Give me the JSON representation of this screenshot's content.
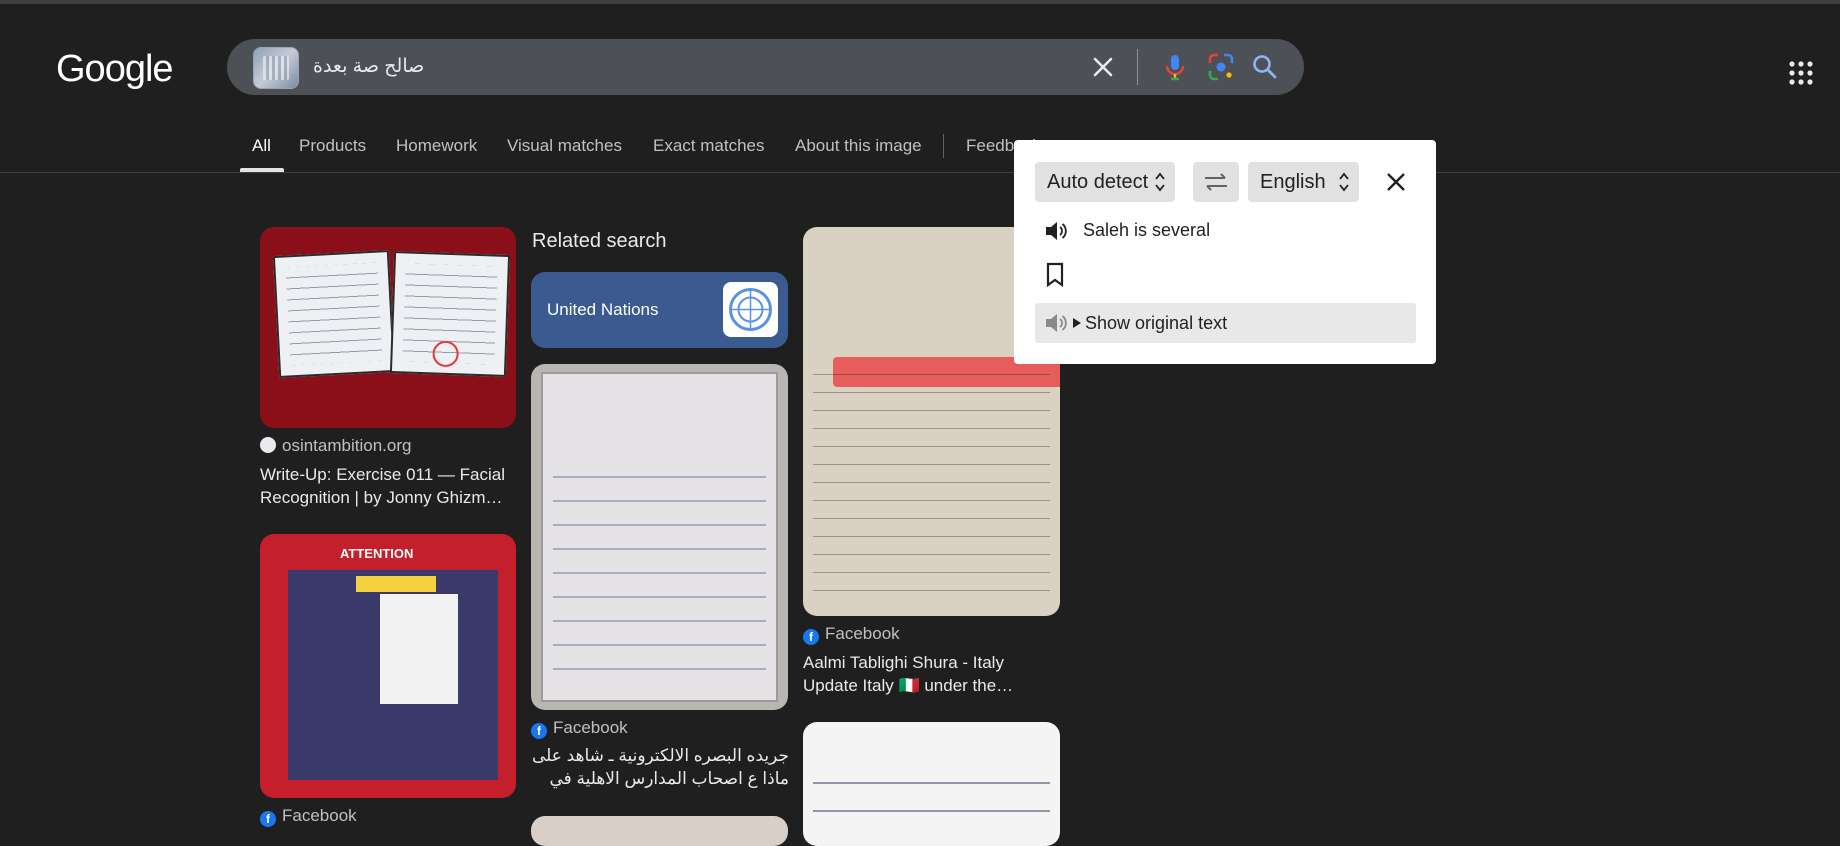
{
  "header": {
    "logo": "Google",
    "search": {
      "query": "صالح صة بعدة"
    }
  },
  "tabs": [
    {
      "label": "All"
    },
    {
      "label": "Products"
    },
    {
      "label": "Homework"
    },
    {
      "label": "Visual matches"
    },
    {
      "label": "Exact matches"
    },
    {
      "label": "About this image"
    },
    {
      "label": "Feedback"
    }
  ],
  "results": {
    "col1": [
      {
        "source": "osintambition.org",
        "title": "Write-Up: Exercise 011 — Facial Recognition | by Jonny Ghizm…"
      },
      {
        "source": "Facebook",
        "attention": "ATTENTION"
      }
    ],
    "related": {
      "heading": "Related search",
      "chip": "United Nations"
    },
    "col2": [
      {
        "source": "Facebook",
        "title": "جريده البصره الالكترونية ـ شاهد على ماذا ع اصحاب المدارس الاهلية في الناصرية !! …"
      }
    ],
    "col3": [
      {
        "source": "Facebook",
        "title": "Aalmi Tablighi Shura - Italy Update Italy 🇮🇹 under the…"
      }
    ]
  },
  "translate_popup": {
    "source_lang": "Auto detect",
    "target_lang": "English",
    "translation": "Saleh is several",
    "show_original": "Show original text"
  },
  "colors": {
    "background": "#1f1f1f",
    "searchbar": "#4d5156",
    "accent_blue": "#8ab4f8",
    "facebook": "#1877f2"
  }
}
